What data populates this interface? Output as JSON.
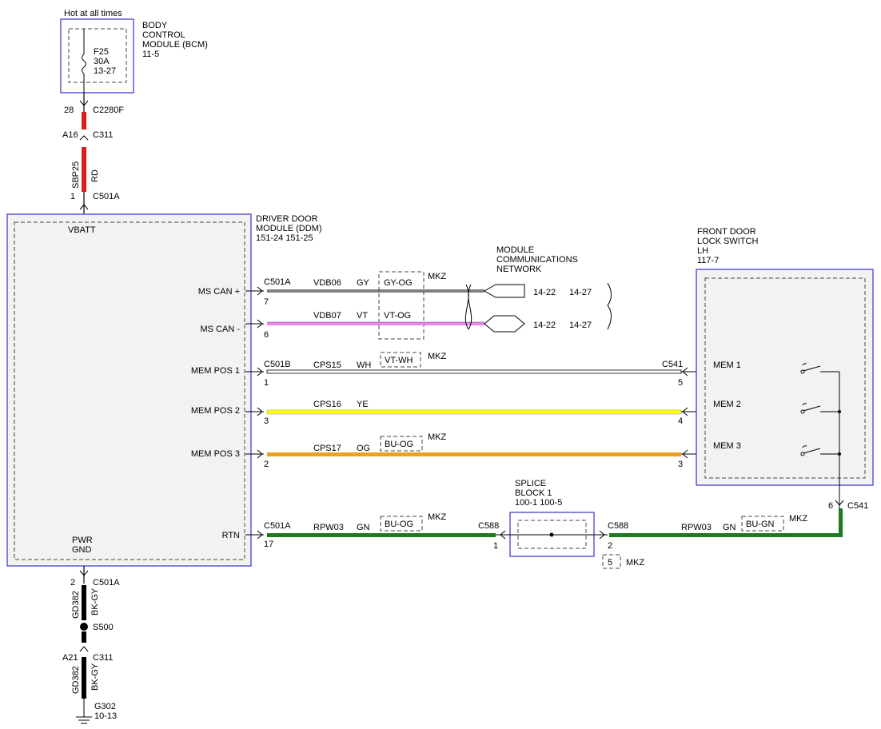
{
  "bcm": {
    "hot": "Hot at all times",
    "l1": "BODY",
    "l2": "CONTROL",
    "l3": "MODULE (BCM)",
    "l4": "11-5",
    "fuse1": "F25",
    "fuse2": "30A",
    "fuse3": "13-27"
  },
  "feed": {
    "pin28": "28",
    "c2280f": "C2280F",
    "a16": "A16",
    "c311": "C311",
    "circuit": "SBP25",
    "color": "RD",
    "pin1": "1",
    "c501a": "C501A"
  },
  "ddm": {
    "l1": "DRIVER DOOR",
    "l2": "MODULE (DDM)",
    "l3": "151-24  151-25",
    "vbatt": "VBATT",
    "pwr": "PWR",
    "gnd": "GND",
    "mscanp": "MS CAN +",
    "mscann": "MS CAN -",
    "mem1": "MEM POS 1",
    "mem2": "MEM POS 2",
    "mem3": "MEM POS 3",
    "rtn": "RTN"
  },
  "net": {
    "l1": "MODULE",
    "l2": "COMMUNICATIONS",
    "l3": "NETWORK",
    "r1a": "14-22",
    "r1b": "14-27",
    "r2a": "14-22",
    "r2b": "14-27"
  },
  "wires": {
    "canp": {
      "conn": "C501A",
      "pin": "7",
      "circuit": "VDB06",
      "color": "GY",
      "alt": "GY-OG",
      "mkz": "MKZ"
    },
    "cann": {
      "pin": "6",
      "circuit": "VDB07",
      "color": "VT",
      "alt": "VT-OG"
    },
    "m1": {
      "conn": "C501B",
      "pin": "1",
      "circuit": "CPS15",
      "color": "WH",
      "alt": "VT-WH",
      "mkz": "MKZ",
      "rconn": "C541",
      "rpin": "5"
    },
    "m2": {
      "pin": "3",
      "circuit": "CPS16",
      "color": "YE",
      "rpin": "4"
    },
    "m3": {
      "pin": "2",
      "circuit": "CPS17",
      "color": "OG",
      "alt": "BU-OG",
      "mkz": "MKZ",
      "rpin": "3"
    },
    "rtn": {
      "conn": "C501A",
      "pin": "17",
      "circuit": "RPW03",
      "color": "GN",
      "alt": "BU-OG",
      "mkz": "MKZ",
      "c588": "C588",
      "spin": "1"
    },
    "rtn2": {
      "c588": "C588",
      "pin": "2",
      "circuit": "RPW03",
      "color": "GN",
      "alt": "BU-GN",
      "mkz": "MKZ",
      "five": "5",
      "mkz2": "MKZ"
    }
  },
  "splice": {
    "l1": "SPLICE",
    "l2": "BLOCK 1",
    "l3": "100-1  100-5"
  },
  "sw": {
    "l1": "FRONT DOOR",
    "l2": "LOCK SWITCH",
    "l3": "LH",
    "l4": "117-7",
    "mem1": "MEM 1",
    "mem2": "MEM 2",
    "mem3": "MEM 3",
    "pin6": "6",
    "c541": "C541"
  },
  "gnd": {
    "pin2": "2",
    "c501a": "C501A",
    "c1": "GD382",
    "col1": "BK-GY",
    "s500": "S500",
    "a21": "A21",
    "c311": "C311",
    "c2": "GD382",
    "col2": "BK-GY",
    "g302": "G302",
    "ref": "10-13"
  },
  "colors": {
    "red": "#e11b1b",
    "gray": "#808080",
    "violet": "#ee82ee",
    "yellow": "#ffff00",
    "orange": "#f0a020",
    "green": "#1e7a1e",
    "black": "#000000",
    "border": "#3333cc"
  }
}
